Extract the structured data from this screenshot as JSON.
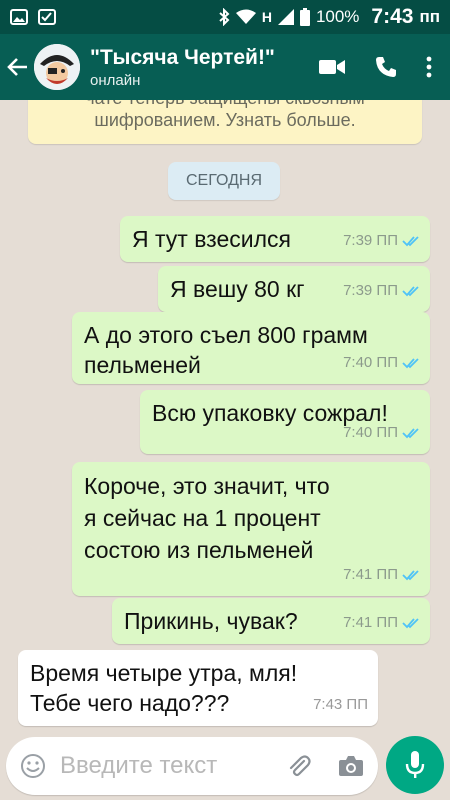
{
  "status": {
    "network": "H",
    "battery": "100%",
    "time": "7:43",
    "ampm": "пп"
  },
  "header": {
    "title": "\"Тысяча Чертей!\"",
    "subtitle": "онлайн"
  },
  "chat": {
    "notice_line1": "чате теперь защищены сквозным",
    "notice_line2": "шифрованием. Узнать больше.",
    "date_label": "СЕГОДНЯ",
    "messages": [
      {
        "dir": "out",
        "lines": [
          "Я тут взесился"
        ],
        "time": "7:39 ПП"
      },
      {
        "dir": "out",
        "lines": [
          "Я вешу 80 кг"
        ],
        "time": "7:39 ПП"
      },
      {
        "dir": "out",
        "lines": [
          "А до этого съел 800 грамм",
          "пельменей"
        ],
        "time": "7:40 ПП"
      },
      {
        "dir": "out",
        "lines": [
          "Всю упаковку сожрал!"
        ],
        "time": "7:40 ПП"
      },
      {
        "dir": "out",
        "lines": [
          "Короче, это значит, что",
          "я сейчас на 1 процент",
          "состою из пельменей"
        ],
        "time": "7:41 ПП"
      },
      {
        "dir": "out",
        "lines": [
          "Прикинь, чувак?"
        ],
        "time": "7:41 ПП"
      },
      {
        "dir": "in",
        "lines": [
          "Время четыре утра, мля!",
          "Тебе чего надо???"
        ],
        "time": "7:43 ПП"
      }
    ]
  },
  "composer": {
    "placeholder": "Введите текст"
  },
  "colors": {
    "statusbar": "#054d44",
    "appbar": "#075e54",
    "outgoing": "#dcf8c6",
    "incoming": "#ffffff",
    "tick": "#4fc3f7",
    "mic": "#00a884"
  }
}
